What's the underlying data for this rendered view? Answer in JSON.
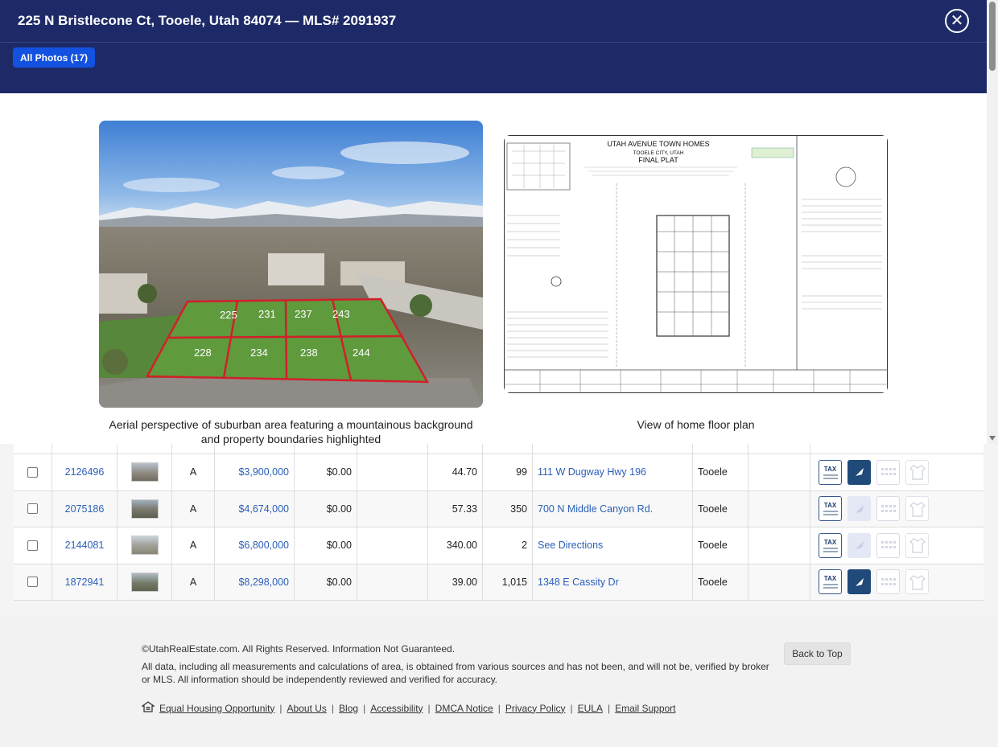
{
  "modal": {
    "title": "225 N Bristlecone Ct, Tooele, Utah 84074 — MLS# 2091937",
    "all_photos_label": "All Photos (17)",
    "close_icon": "close-circle-icon",
    "photos": [
      {
        "caption": "Aerial perspective of suburban area featuring a mountainous background and property boundaries highlighted",
        "lots": [
          "225",
          "231",
          "237",
          "243",
          "228",
          "234",
          "238",
          "244"
        ]
      },
      {
        "caption": "View of home floor plan",
        "plat_title": "UTAH AVENUE TOWN HOMES",
        "plat_city": "TOOELE CITY, UTAH",
        "plat_subtitle": "FINAL PLAT"
      }
    ]
  },
  "listings": [
    {
      "mls": "2126496",
      "status": "A",
      "price": "$3,900,000",
      "fee": "$0.00",
      "acres": "44.70",
      "dom": "99",
      "address": "111 W Dugway Hwy 196",
      "city": "Tooele",
      "map_active": true
    },
    {
      "mls": "2075186",
      "status": "A",
      "price": "$4,674,000",
      "fee": "$0.00",
      "acres": "57.33",
      "dom": "350",
      "address": "700 N Middle Canyon Rd.",
      "city": "Tooele",
      "map_active": false
    },
    {
      "mls": "2144081",
      "status": "A",
      "price": "$6,800,000",
      "fee": "$0.00",
      "acres": "340.00",
      "dom": "2",
      "address": "See Directions",
      "city": "Tooele",
      "map_active": false
    },
    {
      "mls": "1872941",
      "status": "A",
      "price": "$8,298,000",
      "fee": "$0.00",
      "acres": "39.00",
      "dom": "1,015",
      "address": "1348 E Cassity Dr",
      "city": "Tooele",
      "map_active": true
    }
  ],
  "row_icons": {
    "tax_label": "TAX",
    "tax": "tax-document-icon",
    "map": "map-pin-icon",
    "calendar": "calendar-icon",
    "shirt": "open-house-icon"
  },
  "footer": {
    "copyright": "©UtahRealEstate.com. All Rights Reserved. Information Not Guaranteed.",
    "disclaimer": "All data, including all measurements and calculations of area, is obtained from various sources and has not been, and will not be, verified by broker or MLS. All information should be independently reviewed and verified for accuracy.",
    "back_to_top": "Back to Top",
    "links": [
      "Equal Housing Opportunity",
      "About Us",
      "Blog",
      "Accessibility",
      "DMCA Notice",
      "Privacy Policy",
      "EULA",
      "Email Support"
    ]
  },
  "colors": {
    "header_bg": "#1e2a67",
    "button_blue": "#1351e0",
    "link_blue": "#2b5fb8",
    "lot_outline": "#d21f2b"
  }
}
